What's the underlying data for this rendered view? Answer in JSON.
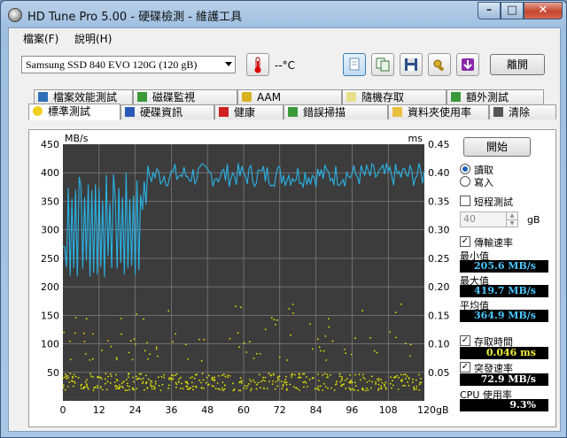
{
  "window": {
    "title": "HD Tune Pro  5.00 - 硬碟檢測 - 維護工具"
  },
  "menu": {
    "file": "檔案(F)",
    "help": "說明(H)"
  },
  "toolbar": {
    "drive": "Samsung SSD 840 EVO 120G (120 gB)",
    "temperature": "--°C",
    "exit": "離開"
  },
  "tabs_back": [
    "檔案效能測試",
    "磁碟監視",
    "AAM",
    "隨機存取",
    "額外測試"
  ],
  "tabs_front": [
    "標準測試",
    "硬碟資訊",
    "健康",
    "錯誤掃描",
    "資料夾使用率",
    "清除"
  ],
  "side": {
    "start": "開始",
    "read": "讀取",
    "write": "寫入",
    "short_test": "短程測試",
    "size_value": "40",
    "size_unit": "gB",
    "transfer_rate": "傳輸速率",
    "min_label": "最小值",
    "min_value": "205.6 MB/s",
    "max_label": "最大值",
    "max_value": "419.7 MB/s",
    "avg_label": "平均值",
    "avg_value": "364.9 MB/s",
    "access_time": "存取時間",
    "access_value": "0.046 ms",
    "burst_rate": "突發速率",
    "burst_value": "72.9 MB/s",
    "cpu_label": "CPU 使用率",
    "cpu_value": "9.3%"
  },
  "colors": {
    "transfer": "#2ab4e8",
    "access": "#e6e600",
    "chart_bg": "#3c3c3c",
    "grid": "#8c8c8c"
  },
  "chart_data": {
    "type": "line",
    "y_left_unit": "MB/s",
    "y_right_unit": "ms",
    "x_unit": "gB",
    "x_ticks": [
      "0",
      "12",
      "24",
      "36",
      "48",
      "60",
      "72",
      "84",
      "96",
      "108",
      "120gB"
    ],
    "y_left_ticks": [
      "450",
      "400",
      "350",
      "300",
      "250",
      "200",
      "150",
      "100",
      "50"
    ],
    "y_right_ticks": [
      "0.45",
      "0.40",
      "0.35",
      "0.30",
      "0.25",
      "0.20",
      "0.15",
      "0.10",
      "0.05"
    ],
    "xlim": [
      0,
      120
    ],
    "ylim_left": [
      0,
      450
    ],
    "ylim_right": [
      0,
      0.45
    ],
    "series": [
      {
        "name": "傳輸速率",
        "axis": "left",
        "color": "#2ab4e8"
      },
      {
        "name": "存取時間",
        "axis": "right",
        "color": "#e6e600"
      }
    ]
  }
}
